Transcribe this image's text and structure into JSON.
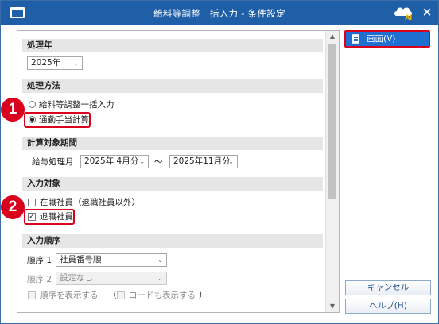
{
  "window": {
    "title": "給料等調整一括入力 - 条件設定",
    "ai_label": "AI",
    "close_glyph": "×"
  },
  "section_year": {
    "title": "処理年",
    "year_value": "2025年"
  },
  "section_method": {
    "title": "処理方法",
    "options": [
      {
        "label": "給料等調整一括入力",
        "selected": false
      },
      {
        "label": "通勤手当計算",
        "selected": true
      }
    ]
  },
  "section_period": {
    "title": "計算対象期間",
    "label": "給与処理月",
    "from": "2025年 4月分",
    "separator": "～",
    "to": "2025年11月分"
  },
  "section_target": {
    "title": "入力対象",
    "options": [
      {
        "label": "在職社員（退職社員以外）",
        "checked": false
      },
      {
        "label": "退職社員",
        "checked": true
      }
    ],
    "check_glyph": "✓"
  },
  "section_order": {
    "title": "入力順序",
    "order1_label": "順序 1",
    "order1_value": "社員番号順",
    "order2_label": "順序 2",
    "order2_value": "設定なし",
    "show_order_label": "順序を表示する",
    "show_code_open": "（",
    "show_code_label": "コードも表示する",
    "show_code_close": "）"
  },
  "side": {
    "screen_button": "画面(V)",
    "cancel_button": "キャンセル",
    "help_button": "ヘルプ(H)"
  },
  "badges": [
    "1",
    "2"
  ],
  "colors": {
    "title_bar": "#1f5fa8",
    "highlight": "#d8001c",
    "primary_button": "#1f6fd1"
  }
}
